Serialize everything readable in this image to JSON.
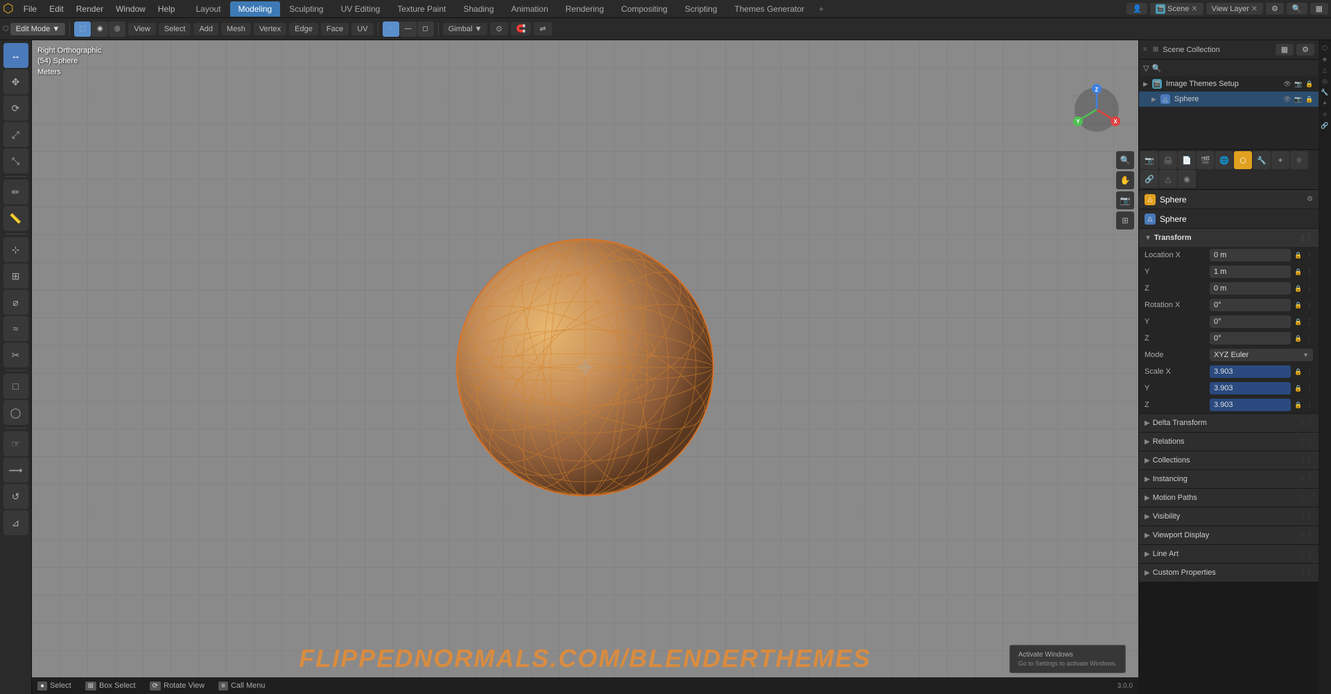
{
  "app": {
    "menus": [
      "File",
      "Edit",
      "Render",
      "Window",
      "Help"
    ]
  },
  "workspace_tabs": {
    "tabs": [
      "Layout",
      "Modeling",
      "Sculpting",
      "UV Editing",
      "Texture Paint",
      "Shading",
      "Animation",
      "Rendering",
      "Compositing",
      "Scripting",
      "Themes Generator"
    ],
    "active": "Modeling"
  },
  "toolbar": {
    "mode": "Edit Mode",
    "mode_icon": "▼",
    "view": "View",
    "select": "Select",
    "add": "Add",
    "mesh": "Mesh",
    "vertex": "Vertex",
    "edge": "Edge",
    "face": "Face",
    "uv": "UV",
    "transform": "Gimbal",
    "pivot": "▼"
  },
  "top_right": {
    "user_icon": "👤",
    "scene_label": "Scene",
    "view_layer": "View Layer",
    "scene_icon": "🎬"
  },
  "viewport": {
    "info_line1": "Right Orthographic",
    "info_line2": "(54) Sphere",
    "info_line3": "Meters",
    "watermark": "FLIPPEDNORMALS.COM/BLENDERTHEMES"
  },
  "status_bar": {
    "select": "Select",
    "box_select": "Box Select",
    "rotate_view": "Rotate View",
    "call_menu": "Call Menu",
    "version": "3.0.0"
  },
  "outliner": {
    "title": "Scene Collection",
    "items": [
      {
        "name": "Image Themes Setup",
        "type": "scene",
        "active": false
      },
      {
        "name": "Sphere",
        "type": "mesh",
        "active": true
      }
    ]
  },
  "properties": {
    "object_name": "Sphere",
    "mesh_name": "Sphere",
    "sections": {
      "transform": {
        "label": "Transform",
        "location": {
          "x": "0 m",
          "y": "1 m",
          "z": "0 m"
        },
        "rotation": {
          "x": "0°",
          "y": "0°",
          "z": "0°"
        },
        "rotation_mode": "XYZ Euler",
        "scale": {
          "x": "3.903",
          "y": "3.903",
          "z": "3.903"
        }
      },
      "delta_transform": {
        "label": "Delta Transform"
      },
      "relations": {
        "label": "Relations"
      },
      "collections": {
        "label": "Collections"
      },
      "instancing": {
        "label": "Instancing"
      },
      "motion_paths": {
        "label": "Motion Paths"
      },
      "visibility": {
        "label": "Visibility"
      },
      "viewport_display": {
        "label": "Viewport Display"
      },
      "line_art": {
        "label": "Line Art"
      },
      "custom_properties": {
        "label": "Custom Properties"
      }
    }
  },
  "gizmo": {
    "x_color": "#e04040",
    "y_color": "#50c050",
    "z_color": "#4080e0"
  },
  "tools": {
    "left": [
      {
        "icon": "↔",
        "name": "select-tool",
        "active": true
      },
      {
        "icon": "⟳",
        "name": "rotate-tool",
        "active": false
      },
      {
        "icon": "⤢",
        "name": "scale-tool",
        "active": false
      },
      {
        "icon": "✥",
        "name": "transform-tool",
        "active": false
      },
      {
        "icon": "⬡",
        "name": "annotate-tool",
        "active": false
      },
      {
        "icon": "⌖",
        "name": "measure-tool",
        "active": false
      },
      {
        "icon": "□",
        "name": "cube-tool",
        "active": false
      },
      {
        "icon": "◯",
        "name": "sphere-tool",
        "active": false
      },
      {
        "icon": "△",
        "name": "cone-tool",
        "active": false
      },
      {
        "icon": "≈",
        "name": "loop-cut-tool",
        "active": false
      },
      {
        "icon": "⊹",
        "name": "extrude-tool",
        "active": false
      },
      {
        "icon": "⊞",
        "name": "inset-tool",
        "active": false
      },
      {
        "icon": "⌀",
        "name": "bevel-tool",
        "active": false
      }
    ]
  }
}
